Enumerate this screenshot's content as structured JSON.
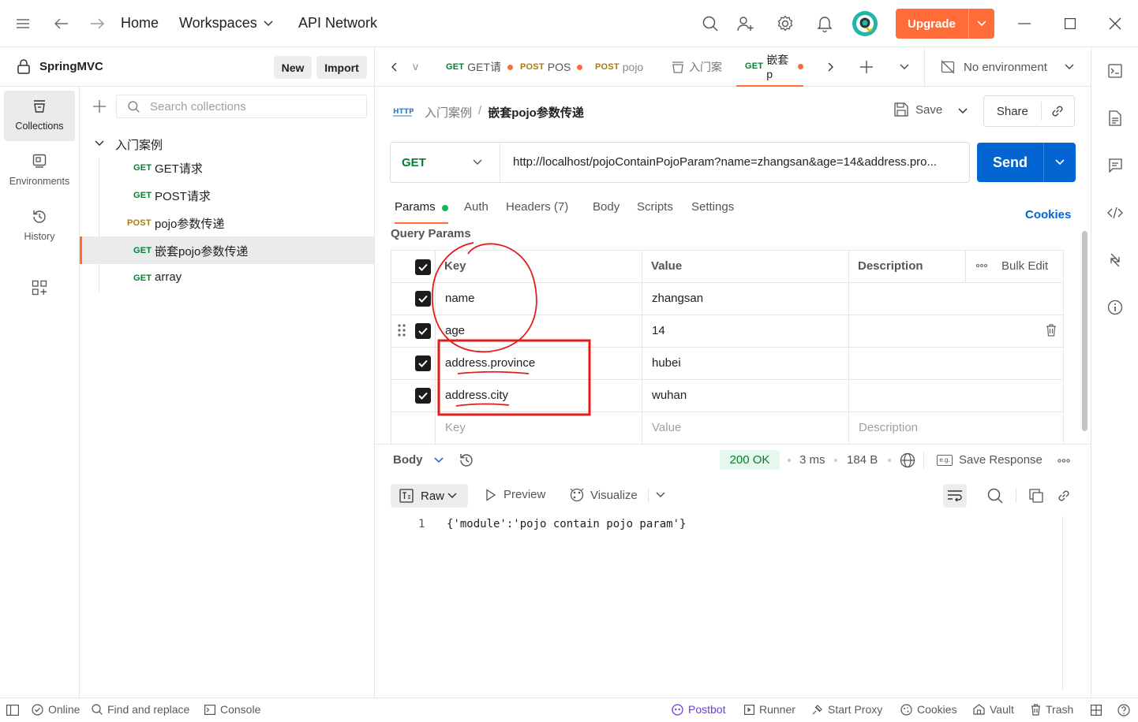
{
  "topbar": {
    "home": "Home",
    "workspaces": "Workspaces",
    "api_network": "API Network",
    "upgrade": "Upgrade"
  },
  "sidebar": {
    "workspace_name": "SpringMVC",
    "new_label": "New",
    "import_label": "Import",
    "rail": [
      {
        "label": "Collections"
      },
      {
        "label": "Environments"
      },
      {
        "label": "History"
      }
    ],
    "search_placeholder": "Search collections",
    "collection_name": "入门案例",
    "items": [
      {
        "method": "GET",
        "name": "GET请求"
      },
      {
        "method": "GET",
        "name": "POST请求"
      },
      {
        "method": "POST",
        "name": "pojo参数传递"
      },
      {
        "method": "GET",
        "name": "嵌套pojo参数传递"
      },
      {
        "method": "GET",
        "name": "array"
      }
    ]
  },
  "tabs": [
    {
      "method": "",
      "label": "v"
    },
    {
      "method": "GET",
      "label": "GET请"
    },
    {
      "method": "POST",
      "label": "POS"
    },
    {
      "method": "POST",
      "label": "pojo"
    },
    {
      "method": "",
      "label": "入门案"
    },
    {
      "method": "GET",
      "label": "嵌套p"
    }
  ],
  "environment": "No environment",
  "request": {
    "breadcrumb_parent": "入门案例",
    "breadcrumb_sep": "/",
    "breadcrumb_current": "嵌套pojo参数传递",
    "save": "Save",
    "share": "Share",
    "method": "GET",
    "url": "http://localhost/pojoContainPojoParam?name=zhangsan&age=14&address.pro...",
    "send": "Send"
  },
  "req_tabs": [
    "Params",
    "Auth",
    "Headers (7)",
    "Body",
    "Scripts",
    "Settings"
  ],
  "cookies": "Cookies",
  "query_params_title": "Query Params",
  "params_table": {
    "headers": {
      "key": "Key",
      "value": "Value",
      "description": "Description",
      "bulk_edit": "Bulk Edit"
    },
    "rows": [
      {
        "key": "name",
        "value": "zhangsan"
      },
      {
        "key": "age",
        "value": "14"
      },
      {
        "key": "address.province",
        "value": "hubei"
      },
      {
        "key": "address.city",
        "value": "wuhan"
      }
    ],
    "placeholders": {
      "key": "Key",
      "value": "Value",
      "description": "Description"
    }
  },
  "response": {
    "body_label": "Body",
    "status": "200 OK",
    "time": "3 ms",
    "size": "184 B",
    "save_response": "Save Response",
    "raw": "Raw",
    "preview": "Preview",
    "visualize": "Visualize",
    "line_number": "1",
    "body": "{'module':'pojo contain pojo param'}"
  },
  "statusbar": {
    "online": "Online",
    "find_replace": "Find and replace",
    "console": "Console",
    "postbot": "Postbot",
    "runner": "Runner",
    "start_proxy": "Start Proxy",
    "cookies": "Cookies",
    "vault": "Vault",
    "trash": "Trash"
  },
  "colors": {
    "accent": "#ff6c37",
    "send": "#0265d2",
    "get": "#007f31",
    "post": "#ad7a03",
    "annotation": "#e51c1c"
  }
}
